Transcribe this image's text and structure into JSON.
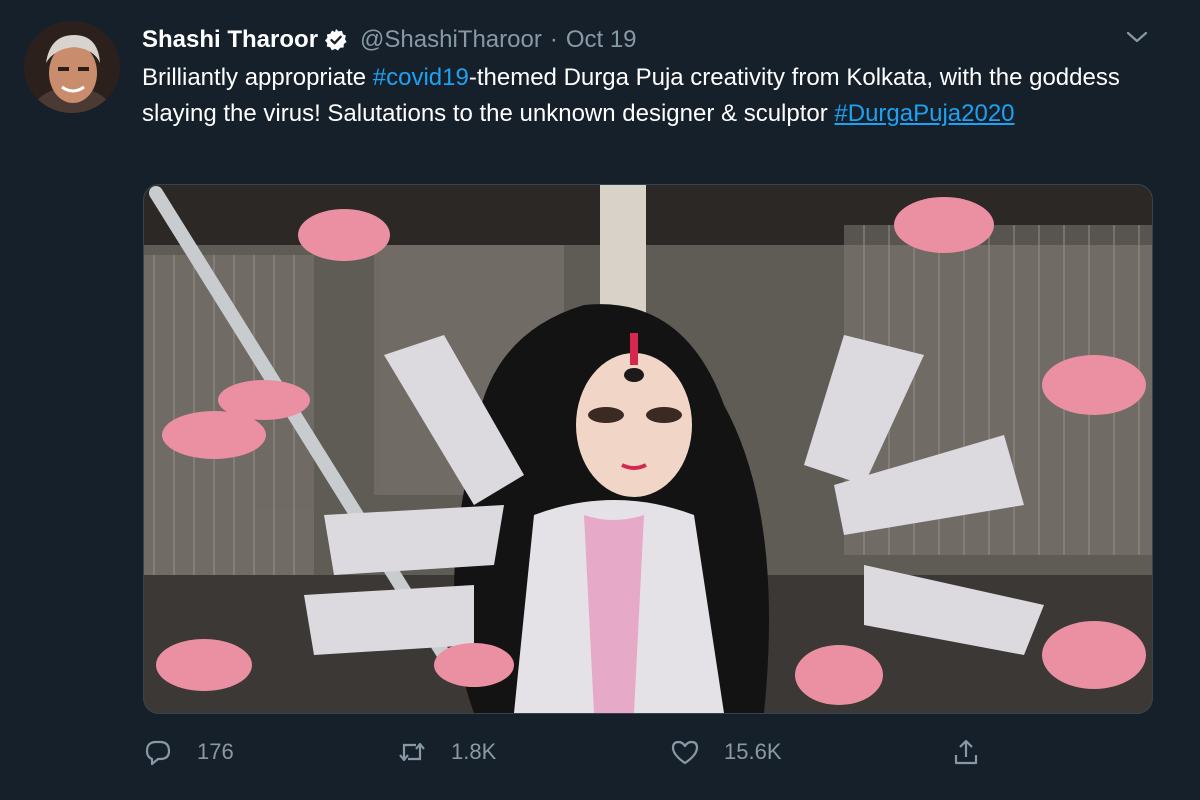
{
  "tweet": {
    "author_name": "Shashi Tharoor",
    "handle": "@ShashiTharoor",
    "separator": "·",
    "date": "Oct 19",
    "text_part1": "Brilliantly appropriate ",
    "hashtag1": "#covid19",
    "text_part2": "-themed Durga Puja creativity from Kolkata, with the goddess slaying the virus! Salutations to the unknown designer & sculptor ",
    "hashtag2": "#DurgaPuja2020"
  },
  "actions": {
    "reply_count": "176",
    "retweet_count": "1.8K",
    "like_count": "15.6K"
  },
  "icons": {
    "verified": "verified-badge-icon",
    "menu": "chevron-down-icon",
    "reply": "reply-icon",
    "retweet": "retweet-icon",
    "like": "heart-icon",
    "share": "share-icon"
  },
  "colors": {
    "background": "#15202b",
    "text": "#ffffff",
    "muted": "#8899a6",
    "link": "#1da1f2"
  }
}
